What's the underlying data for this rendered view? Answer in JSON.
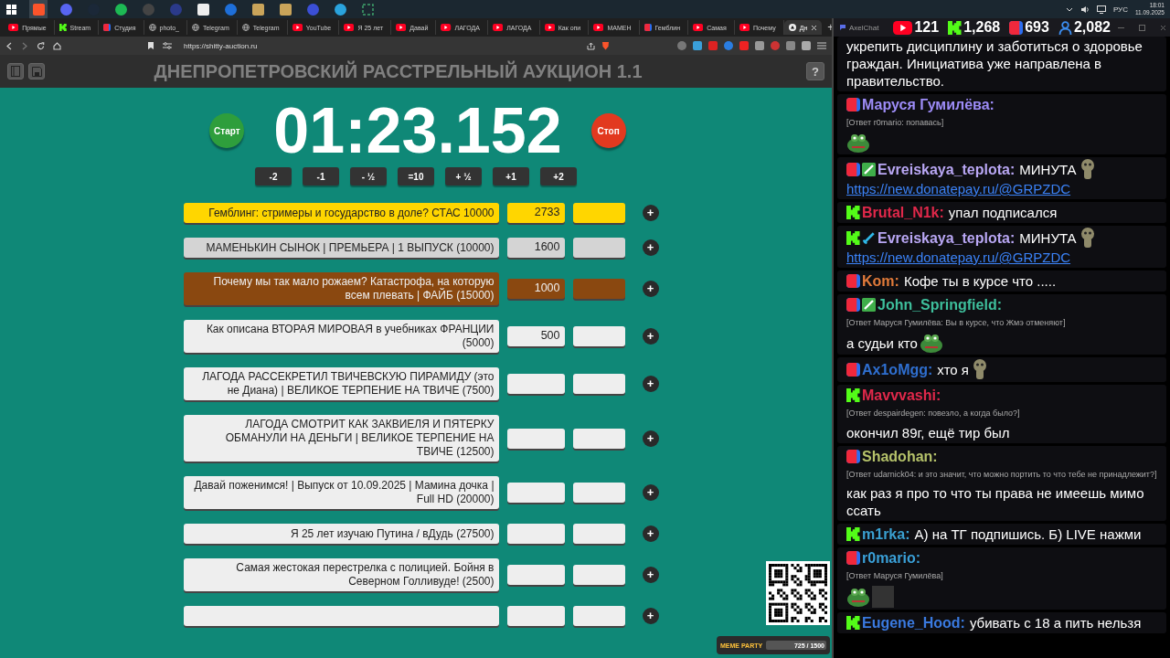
{
  "taskbar": {
    "apps": [
      {
        "kind": "windows",
        "selected": false
      },
      {
        "kind": "shield",
        "selected": true
      },
      {
        "kind": "discord",
        "selected": false
      },
      {
        "kind": "steam",
        "selected": false
      },
      {
        "kind": "spotify",
        "selected": false
      },
      {
        "kind": "record",
        "selected": false
      },
      {
        "kind": "disc",
        "selected": false
      },
      {
        "kind": "block",
        "selected": false
      },
      {
        "kind": "cloud",
        "selected": false
      },
      {
        "kind": "tile",
        "selected": false
      },
      {
        "kind": "tile",
        "selected": false
      },
      {
        "kind": "bubble",
        "selected": false
      },
      {
        "kind": "telegram",
        "selected": false
      },
      {
        "kind": "frame",
        "selected": false
      }
    ],
    "tray": {
      "language": "РУС",
      "time": "18:01",
      "date": "11.09.2025"
    }
  },
  "browser": {
    "tabs": [
      {
        "kind": "youtube",
        "label": "Прямые",
        "selected": false
      },
      {
        "kind": "kick",
        "label": "Stream",
        "selected": false
      },
      {
        "kind": "live",
        "label": "Студия",
        "selected": false
      },
      {
        "kind": "globe",
        "label": "photo_",
        "selected": false
      },
      {
        "kind": "globe",
        "label": "Telegram",
        "selected": false
      },
      {
        "kind": "globe",
        "label": "Telegram",
        "selected": false
      },
      {
        "kind": "youtube",
        "label": "YouTube",
        "selected": false
      },
      {
        "kind": "youtube",
        "label": "Я 25 лет",
        "selected": false
      },
      {
        "kind": "youtube",
        "label": "Давай",
        "selected": false
      },
      {
        "kind": "youtube",
        "label": "ЛАГОДА",
        "selected": false
      },
      {
        "kind": "youtube",
        "label": "ЛАГОДА",
        "selected": false
      },
      {
        "kind": "youtube",
        "label": "Как опи",
        "selected": false
      },
      {
        "kind": "youtube",
        "label": "МАМЕН",
        "selected": false
      },
      {
        "kind": "live",
        "label": "Гемблин",
        "selected": false
      },
      {
        "kind": "youtube",
        "label": "Самая",
        "selected": false
      },
      {
        "kind": "youtube",
        "label": "Почему",
        "selected": false
      },
      {
        "kind": "site",
        "label": "Дн",
        "selected": true
      }
    ],
    "new_tab": "+",
    "url": "https://shitty-auction.ru"
  },
  "app": {
    "title": "ДНЕПРОПЕТРОВСКИЙ РАССТРЕЛЬНЫЙ АУКЦИОН 1.1",
    "help": "?",
    "start": "Старт",
    "timer": "01:23.152",
    "stop": "Стоп",
    "adjust": [
      "-2",
      "-1",
      "- ½",
      "=10",
      "+ ½",
      "+1",
      "+2"
    ],
    "lots": [
      {
        "name": "Гемблинг: стримеры и государство в доле? СТАС 10000",
        "amount": "2733",
        "color": "#ffd600",
        "add": "+"
      },
      {
        "name": "МАМЕНЬКИН СЫНОК | ПРЕМЬЕРА | 1 ВЫПУСК (10000)",
        "amount": "1600",
        "color": "#d4d4d4",
        "add": "+"
      },
      {
        "name": "Почему мы так мало рожаем? Катастрофа, на которую всем плевать | ФАЙБ (15000)",
        "amount": "1000",
        "color": "#8a4810",
        "add": "+"
      },
      {
        "name": "Как описана ВТОРАЯ МИРОВАЯ в учебниках ФРАНЦИИ (5000)",
        "amount": "500",
        "color": "#eeeeee",
        "add": "+"
      },
      {
        "name": "ЛАГОДА РАССЕКРЕТИЛ ТВИЧЕВСКУЮ ПИРАМИДУ (это не Диана) | ВЕЛИКОЕ ТЕРПЕНИЕ НА ТВИЧЕ (7500)",
        "color": "#eeeeee",
        "add": "+"
      },
      {
        "name": "ЛАГОДА СМОТРИТ КАК ЗАКВИЕЛЯ И ПЯТЕРКУ ОБМАНУЛИ НА ДЕНЬГИ | ВЕЛИКОЕ ТЕРПЕНИЕ НА ТВИЧЕ (12500)",
        "color": "#eeeeee",
        "add": "+"
      },
      {
        "name": "Давай поженимся! | Выпуск от 10.09.2025 | Мамина дочка |  Full HD (20000)",
        "color": "#eeeeee",
        "add": "+"
      },
      {
        "name": "Я 25 лет изучаю Путина / вДудь (27500)",
        "color": "#eeeeee",
        "add": "+"
      },
      {
        "name": "Самая жестокая перестрелка с полицией. Бойня в Северном Голливуде! (2500)",
        "color": "#eeeeee",
        "add": "+"
      },
      {
        "color": "#eeeeee",
        "add": "+"
      }
    ],
    "widget": {
      "title": "MEME PARTY",
      "count": "725 / 1500"
    }
  },
  "chat": {
    "app_name": "AxelChat",
    "stats": [
      {
        "kind": "youtube",
        "count": "121"
      },
      {
        "kind": "kick",
        "count": "1,268"
      },
      {
        "kind": "live",
        "count": "693"
      },
      {
        "kind": "viewers",
        "count": "2,082"
      }
    ],
    "messages": [
      {
        "text": "укрепить дисциплину и заботиться о здоровье граждан. Инициатива уже направлена в правительство."
      },
      {
        "icons": [
          {
            "kind": "live"
          }
        ],
        "user": "Маруся Гумилёва:",
        "color": "#9d8cf7",
        "reply": "[Ответ r0mario: попавась]",
        "emotes": [
          {
            "kind": "frog"
          }
        ]
      },
      {
        "icons": [
          {
            "kind": "live"
          },
          {
            "kind": "pencil"
          }
        ],
        "user": "Evreiskaya_teplota:",
        "color": "#b9a7f4",
        "text": "МИНУТА",
        "emotes": [
          {
            "kind": "creature"
          }
        ],
        "link": "https://new.donatepay.ru/@GRPZDC"
      },
      {
        "icons": [
          {
            "kind": "kick"
          }
        ],
        "user": "Brutal_N1k:",
        "color": "#e0284a",
        "text": "упал подписался"
      },
      {
        "icons": [
          {
            "kind": "kick"
          },
          {
            "kind": "sword"
          }
        ],
        "user": "Evreiskaya_teplota:",
        "color": "#b9a7f4",
        "text": "МИНУТА",
        "emotes": [
          {
            "kind": "creature"
          }
        ],
        "link": "https://new.donatepay.ru/@GRPZDC"
      },
      {
        "icons": [
          {
            "kind": "live"
          }
        ],
        "user": "Kom:",
        "color": "#e07a3a",
        "text": "Кофе ты в курсе что ....."
      },
      {
        "icons": [
          {
            "kind": "live"
          },
          {
            "kind": "pencil"
          }
        ],
        "user": "John_Springfield:",
        "color": "#3ebf9c",
        "reply": "[Ответ Маруся Гумилёва: Вы в курсе, что Жмэ отменяют]",
        "text": "а судьи кто",
        "emotes": [
          {
            "kind": "frog"
          }
        ]
      },
      {
        "icons": [
          {
            "kind": "live"
          }
        ],
        "user": "Ax1oMgg:",
        "color": "#2f6fd0",
        "text": "хто я",
        "emotes": [
          {
            "kind": "creature"
          }
        ]
      },
      {
        "icons": [
          {
            "kind": "kick"
          }
        ],
        "user": "Mavvvashi:",
        "color": "#e0284a",
        "reply": "[Ответ despairdegen: повезло, а когда было?]",
        "text": "окончил 89г, ещё тир был"
      },
      {
        "icons": [
          {
            "kind": "live"
          }
        ],
        "user": "Shadohan:",
        "color": "#b5c26a",
        "reply": "[Ответ udarnick04: и это значит, что можно портить то что тебе не принадлежит?]",
        "text": "как раз я про то что ты права не имеешь мимо ссать"
      },
      {
        "icons": [
          {
            "kind": "kick"
          }
        ],
        "user": "m1rka:",
        "color": "#3aa0d0",
        "text": "А) на ТГ подпишись. Б) LIVE нажми"
      },
      {
        "icons": [
          {
            "kind": "live"
          }
        ],
        "user": "r0mario:",
        "color": "#3aa0d8",
        "reply": "[Ответ Маруся Гумилёва]",
        "emotes": [
          {
            "kind": "frog"
          },
          {
            "kind": "photo"
          }
        ]
      },
      {
        "icons": [
          {
            "kind": "kick"
          }
        ],
        "user": "Eugene_Hood:",
        "color": "#3a7ae0",
        "text": "убивать с 18 а пить нельзя"
      }
    ]
  }
}
